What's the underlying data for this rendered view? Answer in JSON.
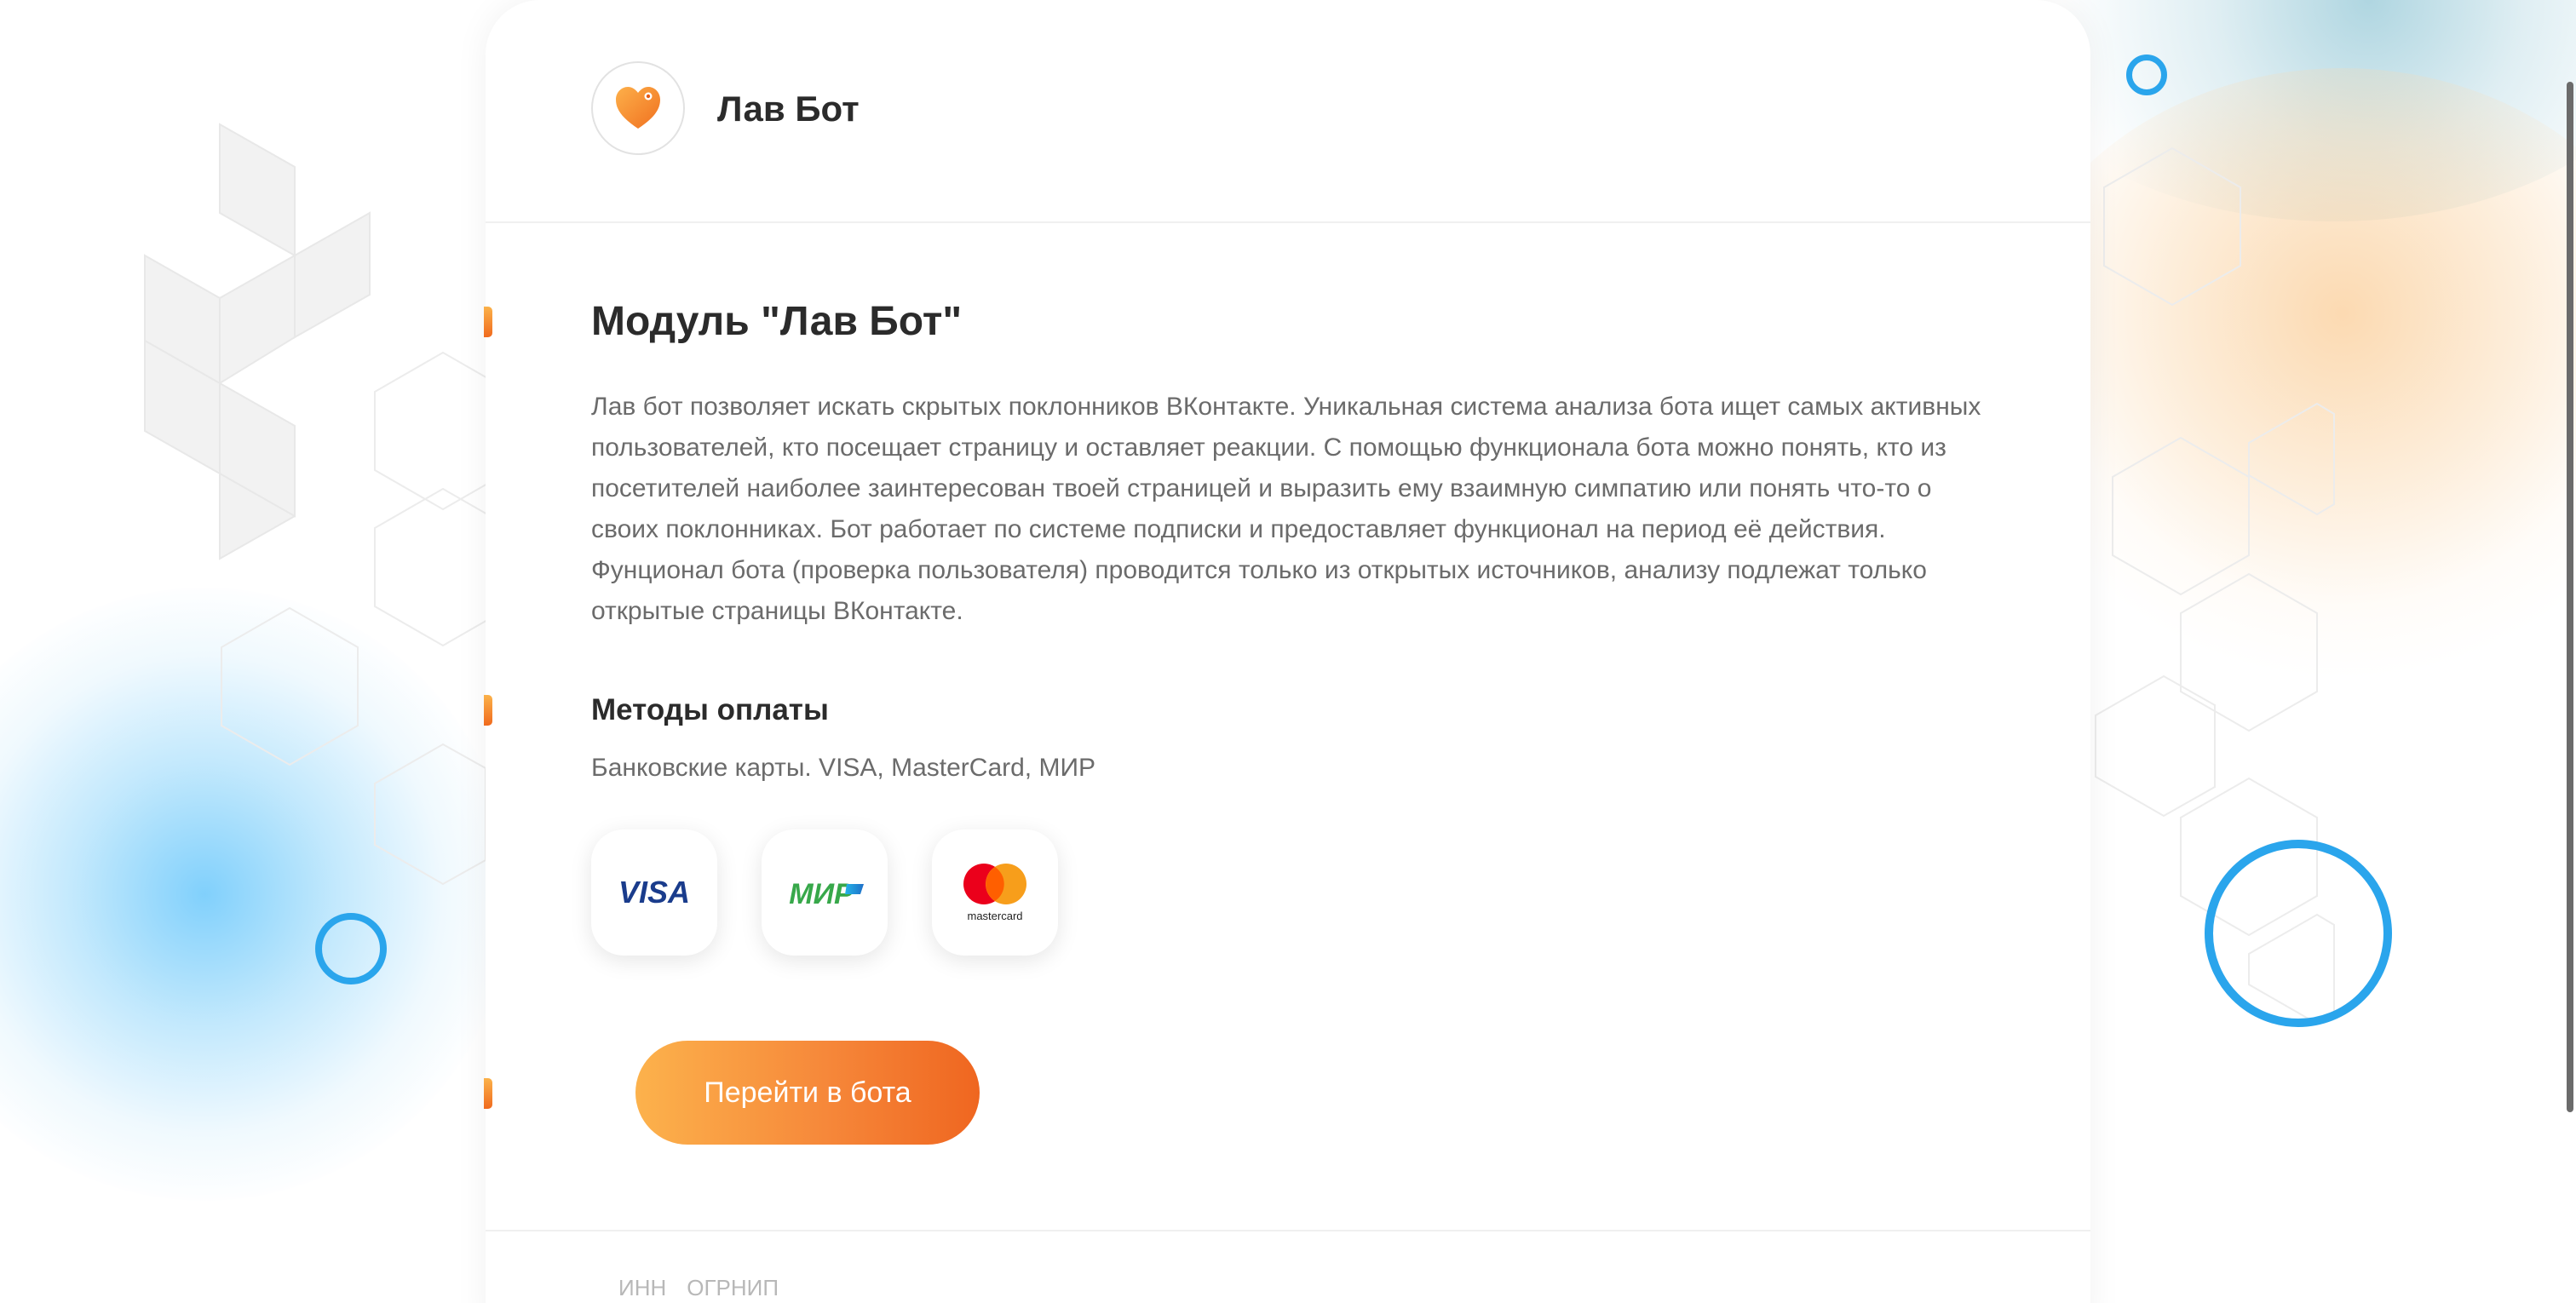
{
  "header": {
    "app_name": "Лав Бот",
    "logo_icon": "heart-icon"
  },
  "module": {
    "title": "Модуль \"Лав Бот\"",
    "description": "Лав бот позволяет искать скрытых поклонников ВКонтакте. Уникальная система анализа бота ищет самых активных пользователей, кто посещает страницу и оставляет реакции. С помощью функционала бота можно понять, кто из посетителей наиболее заинтересован твоей страницей и выразить ему взаимную симпатию или понять что-то о своих поклонниках. Бот работает по системе подписки и предоставляет функционал на период её действия. Фунционал бота (проверка пользователя) проводится только из открытых источников, анализу подлежат только открытые страницы ВКонтакте."
  },
  "payment": {
    "title": "Методы оплаты",
    "text": "Банковские карты. VISA, MasterCard, МИР",
    "methods": [
      {
        "name": "VISA",
        "icon": "visa-logo"
      },
      {
        "name": "МИР",
        "icon": "mir-logo"
      },
      {
        "name": "mastercard",
        "icon": "mastercard-logo"
      }
    ]
  },
  "cta": {
    "label": "Перейти в бота"
  },
  "footer": {
    "inn_label": "ИНН",
    "ogrnip_label": "ОГРНИП"
  },
  "colors": {
    "accent_start": "#fcb24c",
    "accent_end": "#ef6620",
    "ring_blue": "#2aa5ec",
    "text_dark": "#2b2b2b",
    "text_muted": "#6b6b6b"
  }
}
